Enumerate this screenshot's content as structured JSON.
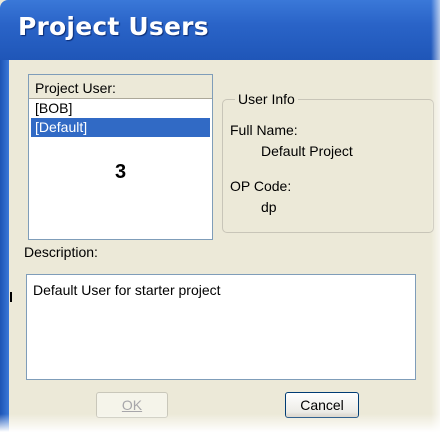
{
  "window": {
    "title": "Project Users"
  },
  "users_list": {
    "header": "Project User:",
    "items": [
      {
        "label": "[BOB]",
        "selected": false
      },
      {
        "label": "[Default]",
        "selected": true
      }
    ],
    "annotation_number": "3"
  },
  "user_info": {
    "legend": "User Info",
    "full_name_label": "Full Name:",
    "full_name_value": "Default Project",
    "op_code_label": "OP Code:",
    "op_code_value": "dp"
  },
  "description": {
    "label": "Description:",
    "value": "Default User for starter project"
  },
  "buttons": {
    "ok_label": "OK",
    "ok_enabled": false,
    "cancel_label": "Cancel"
  },
  "colors": {
    "titlebar": "#2a64c8",
    "selection": "#316ac5",
    "dialog_bg": "#ece9d8"
  }
}
